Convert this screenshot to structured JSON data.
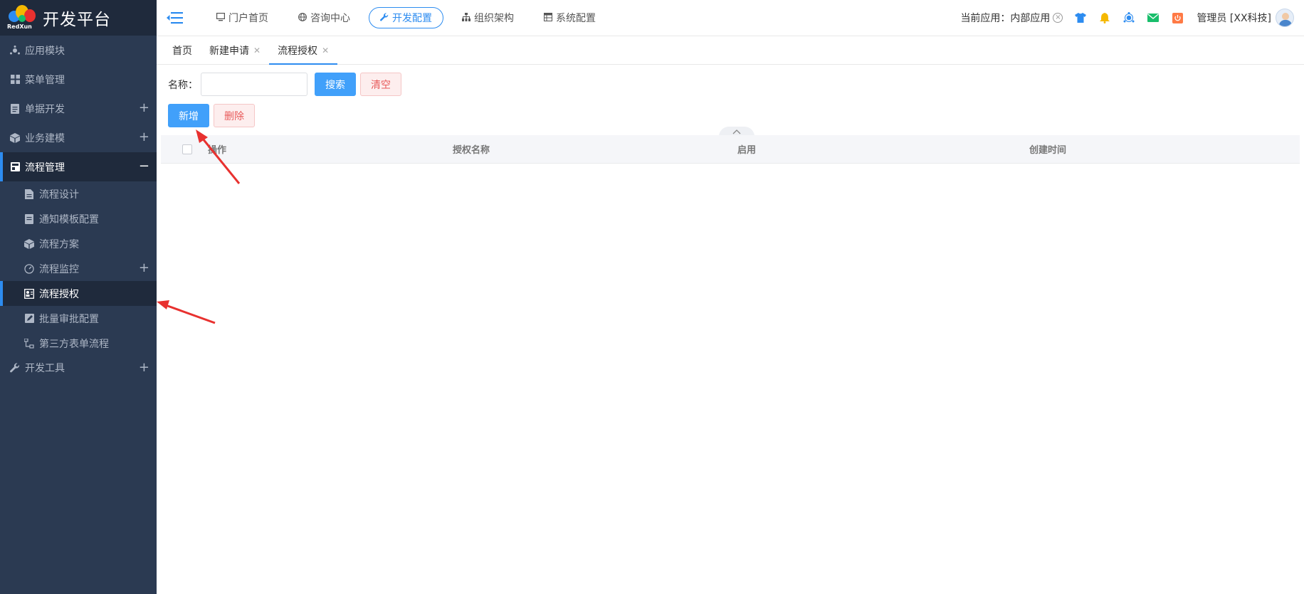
{
  "app": {
    "title": "开发平台",
    "brand_sub": "RedXun"
  },
  "sidebar": {
    "items": [
      {
        "label": "应用模块",
        "icon": "app-module-icon",
        "expandable": false
      },
      {
        "label": "菜单管理",
        "icon": "grid-icon",
        "expandable": false
      },
      {
        "label": "单据开发",
        "icon": "document-icon",
        "expandable": true
      },
      {
        "label": "业务建模",
        "icon": "cube-icon",
        "expandable": true
      },
      {
        "label": "流程管理",
        "icon": "workflow-icon",
        "expandable": true,
        "open": true
      },
      {
        "label": "开发工具",
        "icon": "wrench-icon",
        "expandable": true
      }
    ],
    "sub_items": [
      {
        "label": "流程设计",
        "icon": "file-icon"
      },
      {
        "label": "通知模板配置",
        "icon": "template-icon"
      },
      {
        "label": "流程方案",
        "icon": "cube-icon"
      },
      {
        "label": "流程监控",
        "icon": "gauge-icon",
        "expandable": true
      },
      {
        "label": "流程授权",
        "icon": "authorize-icon",
        "active": true
      },
      {
        "label": "批量审批配置",
        "icon": "edit-icon"
      },
      {
        "label": "第三方表单流程",
        "icon": "sitemap-icon"
      }
    ],
    "expand_symbol": "+",
    "collapse_symbol": "−"
  },
  "topnav": {
    "items": [
      {
        "label": "门户首页",
        "icon": "monitor-icon"
      },
      {
        "label": "咨询中心",
        "icon": "globe-icon"
      },
      {
        "label": "开发配置",
        "icon": "wrench-icon",
        "active": true
      },
      {
        "label": "组织架构",
        "icon": "org-icon"
      },
      {
        "label": "系统配置",
        "icon": "table-icon"
      }
    ]
  },
  "topright": {
    "current_app_label": "当前应用：内部应用",
    "user_label": "管理员 [XX科技]",
    "icons": [
      "shirt-icon",
      "bell-icon",
      "app-module-icon",
      "mail-icon",
      "power-icon"
    ],
    "colors": {
      "shirt": "#2d8cf0",
      "bell": "#f5b800",
      "module": "#2d8cf0",
      "mail": "#19be6b",
      "power": "#ff7a45"
    }
  },
  "tabs": {
    "items": [
      {
        "label": "首页",
        "closable": false
      },
      {
        "label": "新建申请",
        "closable": true
      },
      {
        "label": "流程授权",
        "closable": true,
        "active": true
      }
    ]
  },
  "search": {
    "label": "名称：",
    "value": "",
    "placeholder": "",
    "search_button": "搜索",
    "clear_button": "清空"
  },
  "actions": {
    "add_button": "新增",
    "delete_button": "删除"
  },
  "table": {
    "columns": [
      "操作",
      "授权名称",
      "启用",
      "创建时间"
    ],
    "rows": []
  },
  "colors": {
    "accent": "#2d8cf0",
    "sidebar_bg": "#2b3a52",
    "sidebar_active_bg": "#1f2a3c",
    "annotation_arrow": "#e8312f"
  }
}
